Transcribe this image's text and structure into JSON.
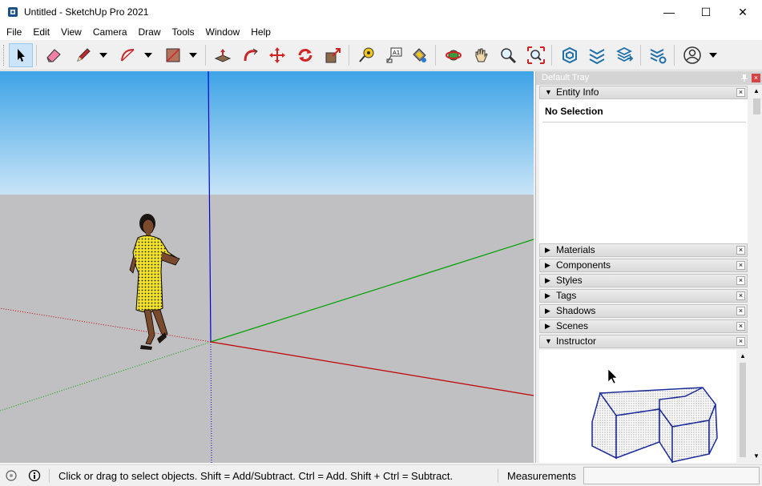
{
  "window": {
    "title": "Untitled - SketchUp Pro 2021",
    "minimize": "—",
    "maximize": "☐",
    "close": "✕"
  },
  "menu": [
    "File",
    "Edit",
    "View",
    "Camera",
    "Draw",
    "Tools",
    "Window",
    "Help"
  ],
  "toolbar": {
    "tools": [
      "select-icon",
      "eraser-icon",
      "pencil-icon",
      "arc-icon",
      "rectangle-icon",
      "push-pull-icon",
      "follow-me-icon",
      "move-icon",
      "rotate-icon",
      "scale-icon",
      "tape-measure-icon",
      "text-icon",
      "paint-bucket-icon",
      "orbit-icon",
      "pan-icon",
      "zoom-icon",
      "zoom-extents-icon",
      "warehouse-icon",
      "extension-warehouse-icon",
      "layout-icon",
      "extension-manager-icon",
      "account-icon"
    ],
    "selected_tool": "select-icon"
  },
  "tray": {
    "title": "Default Tray",
    "pin": "📌",
    "close": "×",
    "entity_info": {
      "label": "Entity Info",
      "arrow": "▼",
      "status": "No Selection"
    },
    "panels": [
      {
        "label": "Materials",
        "arrow": "▶"
      },
      {
        "label": "Components",
        "arrow": "▶"
      },
      {
        "label": "Styles",
        "arrow": "▶"
      },
      {
        "label": "Tags",
        "arrow": "▶"
      },
      {
        "label": "Shadows",
        "arrow": "▶"
      },
      {
        "label": "Scenes",
        "arrow": "▶"
      }
    ],
    "instructor": {
      "label": "Instructor",
      "arrow": "▼"
    },
    "panel_close": "×"
  },
  "statusbar": {
    "hint": "Click or drag to select objects. Shift = Add/Subtract. Ctrl = Add. Shift + Ctrl = Subtract.",
    "measurements_label": "Measurements",
    "measurements_value": ""
  },
  "colors": {
    "axis_red": "#c00000",
    "axis_green": "#00a000",
    "axis_blue": "#0000d0",
    "sky_top": "#3ea3e6",
    "ground": "#c0c0c2"
  }
}
